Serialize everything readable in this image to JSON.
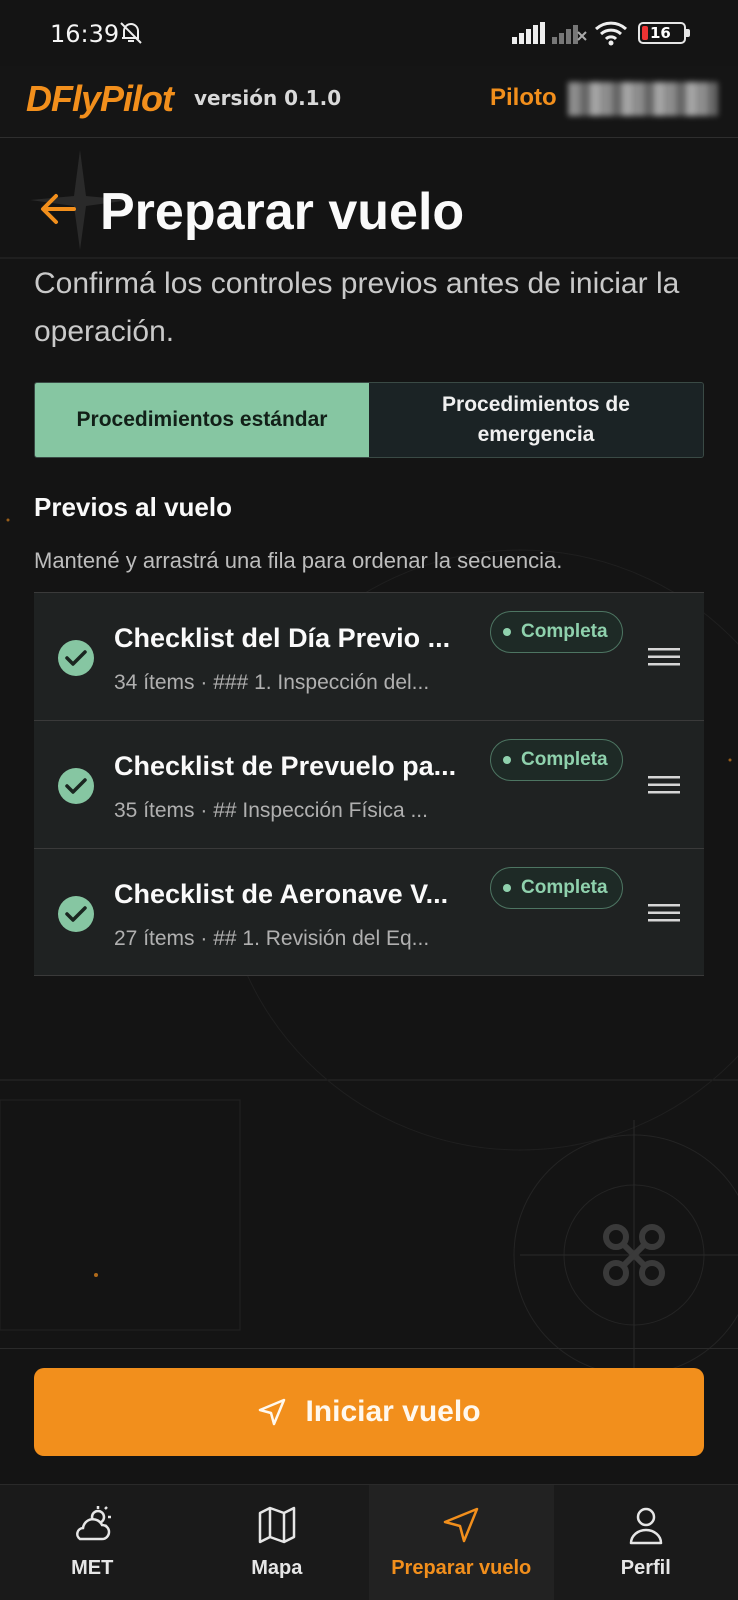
{
  "status_bar": {
    "time": "16:39",
    "battery": "16"
  },
  "header": {
    "logo": "DFlyPilot",
    "version": "versión 0.1.0",
    "pilot_label": "Piloto"
  },
  "page": {
    "title": "Preparar vuelo",
    "subtitle": "Confirmá los controles previos antes de iniciar la operación."
  },
  "segmented": {
    "standard": "Procedimientos estándar",
    "emergency": "Procedimientos de emergencia",
    "active": "standard"
  },
  "section": {
    "title": "Previos al vuelo",
    "hint": "Mantené y arrastrá una fila para ordenar la secuencia."
  },
  "checklists": [
    {
      "title": "Checklist del Día Previo ...",
      "subtitle": "34 ítems · ### 1. Inspección del...",
      "status": "Completa"
    },
    {
      "title": "Checklist de Prevuelo pa...",
      "subtitle": "35 ítems · ## Inspección Física ...",
      "status": "Completa"
    },
    {
      "title": "Checklist de Aeronave V...",
      "subtitle": "27 ítems · ## 1. Revisión del Eq...",
      "status": "Completa"
    }
  ],
  "start_button": {
    "label": "Iniciar vuelo"
  },
  "nav": {
    "items": [
      {
        "label": "MET",
        "icon": "cloud-sun-icon"
      },
      {
        "label": "Mapa",
        "icon": "map-icon"
      },
      {
        "label": "Preparar vuelo",
        "icon": "navigation-arrow-icon"
      },
      {
        "label": "Perfil",
        "icon": "user-icon"
      }
    ],
    "active_index": 2
  },
  "colors": {
    "accent": "#f28f1c",
    "success": "#86c6a2",
    "background": "#141414"
  }
}
